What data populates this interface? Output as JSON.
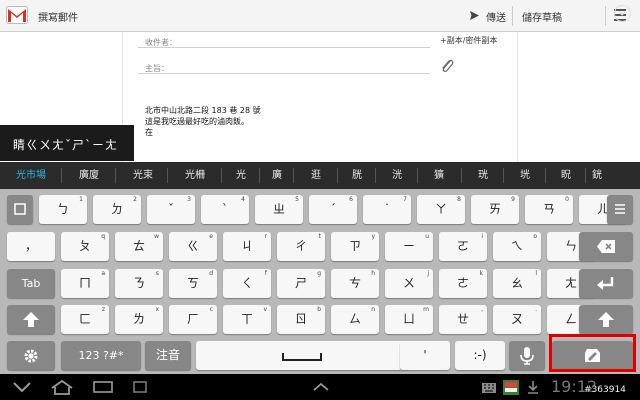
{
  "action_bar": {
    "title": "撰寫郵件",
    "send_label": "傳送",
    "save_draft_label": "儲存草稿",
    "accent_color": "#d93025"
  },
  "compose": {
    "recipients_placeholder": "收件者：",
    "cc_bcc_label": "+副本/密件副本",
    "subject_placeholder": "主旨：",
    "body_lines": [
      "北市中山北路二段 183 巷 28 號",
      "這是我吃過最好吃的滷肉飯。",
      "在"
    ]
  },
  "composing_text": "睛ㄍㄨㄤˇㄕˋㄧㄤ",
  "candidates": [
    "光市場",
    "廣廈",
    "光束",
    "光柵",
    "光",
    "廣",
    "逛",
    "胱",
    "洸",
    "獷",
    "珖",
    "垙",
    "眖",
    "銧"
  ],
  "keyboard": {
    "row1": [
      {
        "label": "ㄅ",
        "sub": "1"
      },
      {
        "label": "ㄉ",
        "sub": "2"
      },
      {
        "label": "ˇ",
        "sub": "3"
      },
      {
        "label": "ˋ",
        "sub": "4"
      },
      {
        "label": "ㄓ",
        "sub": "5"
      },
      {
        "label": "ˊ",
        "sub": "6"
      },
      {
        "label": "˙",
        "sub": "7"
      },
      {
        "label": "ㄚ",
        "sub": "8"
      },
      {
        "label": "ㄞ",
        "sub": "9"
      },
      {
        "label": "ㄢ",
        "sub": "0"
      },
      {
        "label": "ㄦ",
        "sub": ""
      }
    ],
    "row2": [
      {
        "label": "，",
        "sub": ""
      },
      {
        "label": "ㄆ",
        "sub": "q"
      },
      {
        "label": "ㄊ",
        "sub": "w"
      },
      {
        "label": "ㄍ",
        "sub": "e"
      },
      {
        "label": "ㄐ",
        "sub": "r"
      },
      {
        "label": "ㄔ",
        "sub": "t"
      },
      {
        "label": "ㄗ",
        "sub": "y"
      },
      {
        "label": "ㄧ",
        "sub": "u"
      },
      {
        "label": "ㄛ",
        "sub": "i"
      },
      {
        "label": "ㄟ",
        "sub": "o"
      },
      {
        "label": "ㄣ",
        "sub": "p"
      }
    ],
    "row3": [
      {
        "label": "Tab",
        "sub": ""
      },
      {
        "label": "ㄇ",
        "sub": "a"
      },
      {
        "label": "ㄋ",
        "sub": "s"
      },
      {
        "label": "ㄎ",
        "sub": "d"
      },
      {
        "label": "ㄑ",
        "sub": "f"
      },
      {
        "label": "ㄕ",
        "sub": "g"
      },
      {
        "label": "ㄘ",
        "sub": "h"
      },
      {
        "label": "ㄨ",
        "sub": "j"
      },
      {
        "label": "ㄜ",
        "sub": "k"
      },
      {
        "label": "ㄠ",
        "sub": "l"
      },
      {
        "label": "ㄤ",
        "sub": ";"
      }
    ],
    "row4": [
      {
        "label": "ㄈ",
        "sub": "z"
      },
      {
        "label": "ㄌ",
        "sub": "x"
      },
      {
        "label": "ㄏ",
        "sub": "c"
      },
      {
        "label": "ㄒ",
        "sub": "v"
      },
      {
        "label": "ㄖ",
        "sub": "b"
      },
      {
        "label": "ㄙ",
        "sub": "n"
      },
      {
        "label": "ㄩ",
        "sub": "m"
      },
      {
        "label": "ㄝ",
        "sub": ","
      },
      {
        "label": "ㄡ",
        "sub": "."
      },
      {
        "label": "ㄥ",
        "sub": "/"
      }
    ],
    "row5": {
      "symbols_label": "123 ?#*",
      "zhuyin_label": "注音",
      "space_label": "␣",
      "apostrophe_label": "'",
      "smiley_label": ":-)"
    }
  },
  "status_bar": {
    "clock": "19:12",
    "watermark": "#363914"
  }
}
